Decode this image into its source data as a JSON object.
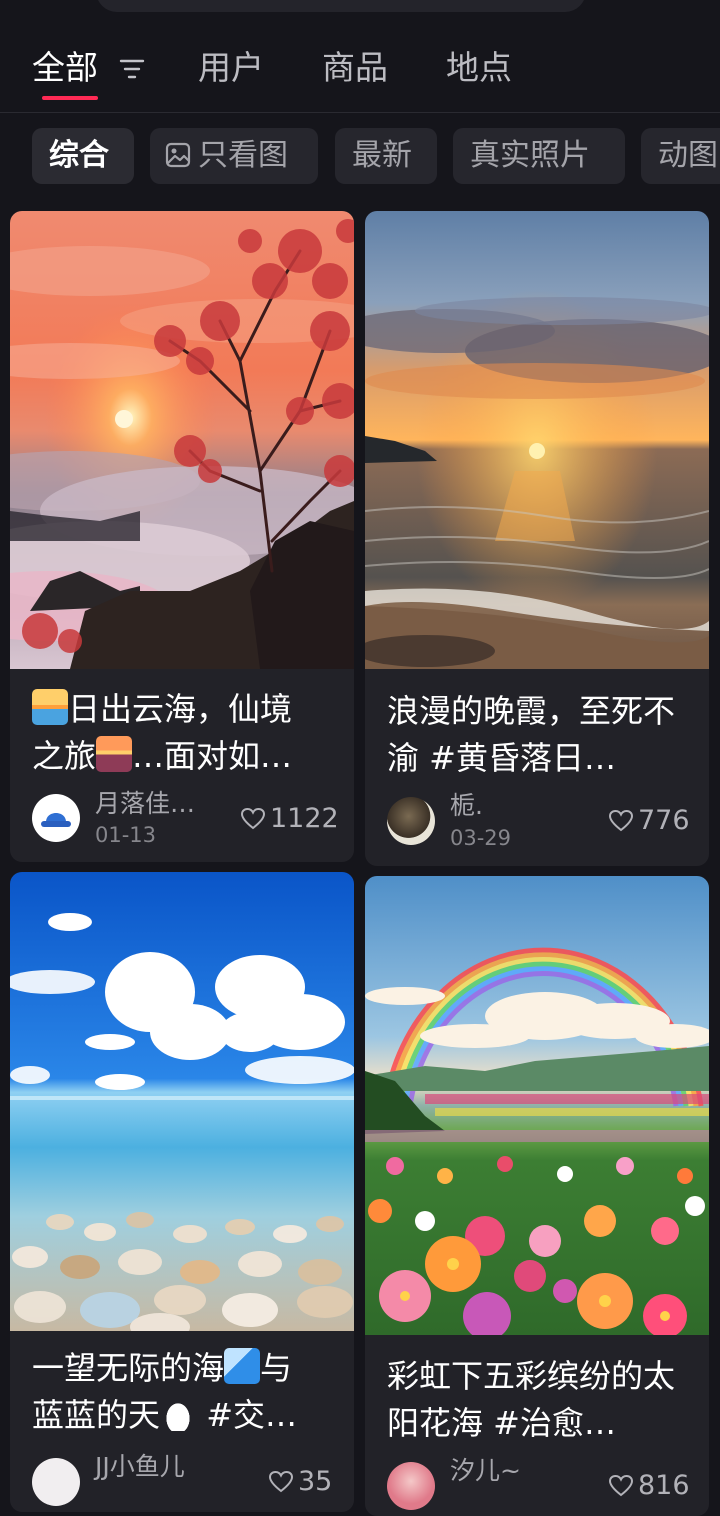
{
  "tabs": [
    {
      "label": "全部",
      "active": true
    },
    {
      "label": "用户"
    },
    {
      "label": "商品"
    },
    {
      "label": "地点"
    }
  ],
  "filters": [
    {
      "label": "综合",
      "active": true
    },
    {
      "label": "只看图",
      "icon": "image-icon"
    },
    {
      "label": "最新"
    },
    {
      "label": "真实照片"
    },
    {
      "label": "动图"
    }
  ],
  "accent_color": "#ff2a55",
  "notes": [
    {
      "title": "🌅日出云海，仙境之旅🌄…面对如…",
      "title_parts": [
        "日出云海，仙境",
        "之旅",
        "…面对如…"
      ],
      "author": "月落佳…",
      "date": "01-13",
      "likes": "1122"
    },
    {
      "title": "浪漫的晚霞，至死不渝 #黄昏落日…",
      "author": "栀.",
      "date": "03-29",
      "likes": "776"
    },
    {
      "title": "一望无际的海🌊与蓝蓝的天☁️ #交…",
      "title_parts": [
        "一望无际的海",
        "与",
        "蓝蓝的天",
        " #交…"
      ],
      "author": "JJ小鱼儿",
      "likes": "35"
    },
    {
      "title": "彩虹下五彩缤纷的太阳花海 #治愈…",
      "author": "汐儿~",
      "likes": "816"
    }
  ]
}
